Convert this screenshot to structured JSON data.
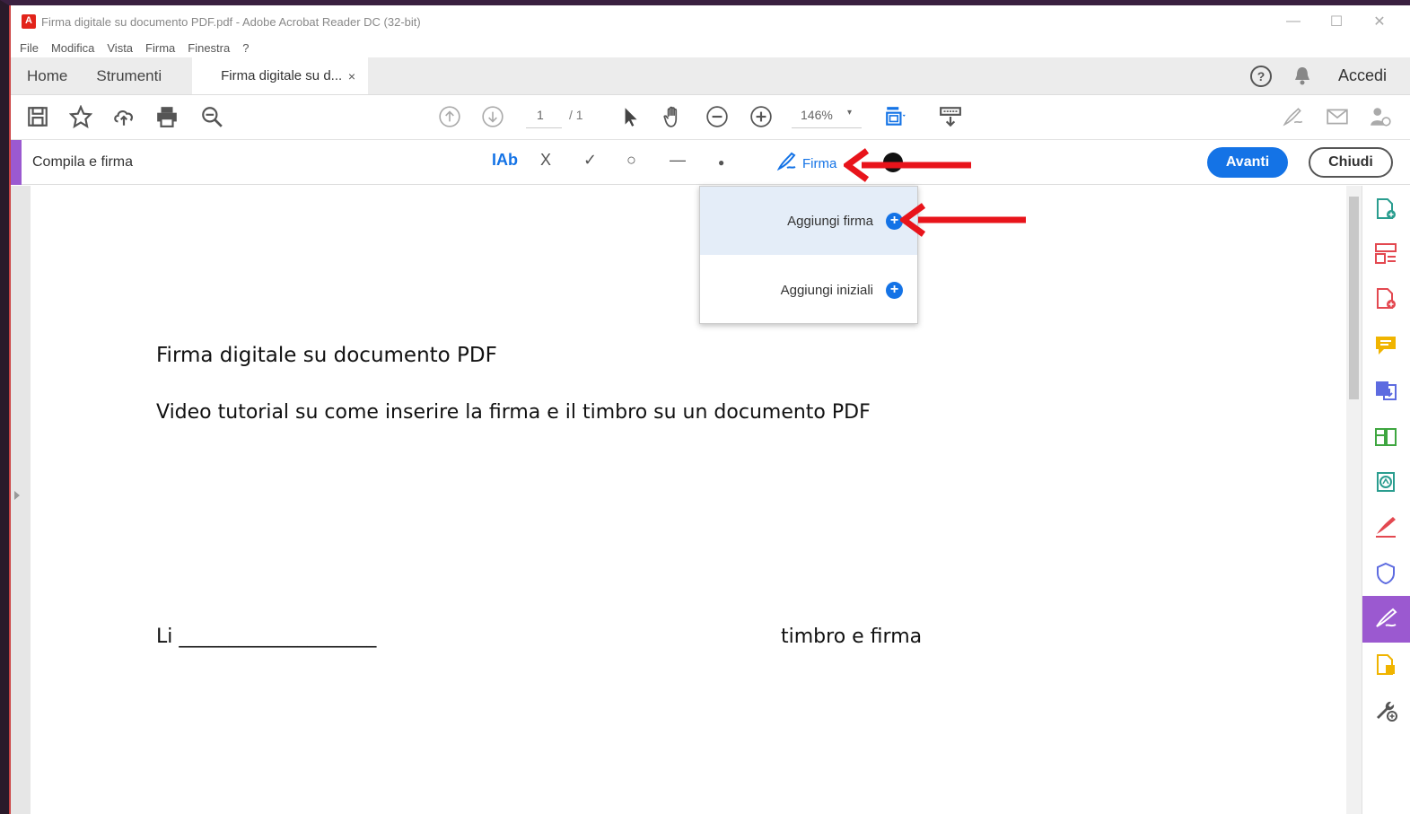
{
  "window": {
    "title": "Firma digitale su documento PDF.pdf - Adobe Acrobat Reader DC (32-bit)",
    "controls": [
      "—",
      "☐",
      "✕"
    ]
  },
  "menu": [
    "File",
    "Modifica",
    "Vista",
    "Firma",
    "Finestra",
    "?"
  ],
  "tabs": {
    "home": "Home",
    "tools": "Strumenti",
    "document": "Firma digitale su d...",
    "close": "×",
    "sign_in": "Accedi"
  },
  "toolbar": {
    "page_current": "1",
    "page_total": "/ 1",
    "zoom": "146%",
    "zoom_caret": "▾"
  },
  "fill_sign": {
    "title": "Compila e firma",
    "text_tool": "IAb",
    "cross_tool": "X",
    "check_tool": "✓",
    "circle_tool": "○",
    "line_tool": "—",
    "dot_tool": "●",
    "sign_label": "Firma",
    "next_button": "Avanti",
    "close_button": "Chiudi"
  },
  "dropdown": {
    "items": [
      {
        "label": "Aggiungi firma",
        "icon": "plus-circle-icon"
      },
      {
        "label": "Aggiungi iniziali",
        "icon": "plus-circle-icon"
      }
    ]
  },
  "document": {
    "title": "Firma digitale su documento PDF",
    "subtitle": "Video tutorial su come inserire la firma e il timbro su un documento PDF",
    "place_line": "Li ____________________",
    "signature_label": "timbro e firma"
  },
  "right_panel_icons": [
    "create-pdf-icon",
    "organize-pages-icon",
    "export-pdf-icon",
    "comment-icon",
    "edit-pdf-icon",
    "compress-icon",
    "protect-edit-icon",
    "fill-sign-icon",
    "shield-icon",
    "fill-sign-active-icon",
    "send-for-review-icon",
    "more-tools-icon"
  ],
  "colors": {
    "accent_blue": "#1473e6",
    "fill_sign_purple": "#9b59d0",
    "annotation_red": "#e8141b"
  }
}
